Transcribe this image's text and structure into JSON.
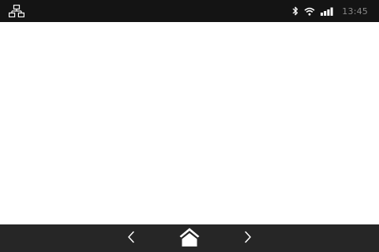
{
  "status_bar": {
    "left_icon": "network-icon",
    "right_icons": [
      "bluetooth-icon",
      "wifi-icon",
      "signal-icon"
    ],
    "time": "13:45"
  },
  "nav_bar": {
    "buttons": [
      "back-icon",
      "home-icon",
      "forward-icon"
    ]
  },
  "colors": {
    "status_bar_bg": "#141414",
    "nav_bar_bg": "#262626",
    "icon": "#ffffff",
    "clock": "#8a8a8a",
    "content_bg": "#ffffff"
  }
}
